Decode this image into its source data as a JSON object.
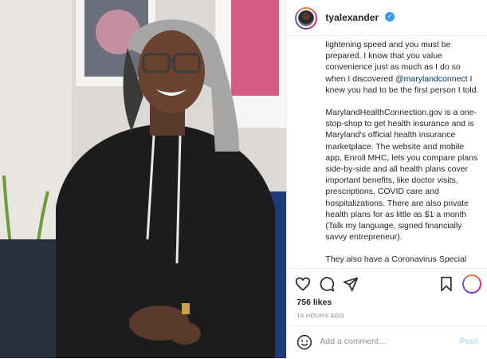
{
  "post": {
    "username": "tyalexander",
    "verified_mark": "✓",
    "caption_paragraphs": [
      {
        "before": "lightening speed and you must be prepared. I know that you value convenience just as much as I do so when I discovered ",
        "mention": "@marylandconnect",
        "after": " I knew you had to be the first person I told."
      },
      {
        "text": "MarylandHealthConnection.gov is a one-stop-shop to get health insurance and is Maryland's official health insurance marketplace. The website and mobile app, Enroll MHC, lets you compare plans side-by-side and all health plans cover important benefits, like doctor visits, prescriptions, COVID care and hospitalizations. There are also private health plans for as little as $1 a month (Talk my language, signed financially savvy entrepreneur)."
      },
      {
        "text": "They also have a Coronavirus Special"
      }
    ],
    "likes": "756 likes",
    "timestamp": "18 HOURS AGO",
    "comment_placeholder": "Add a comment…",
    "post_button": "Post"
  },
  "icons": {
    "like": "heart-outline-icon",
    "comment": "comment-bubble-icon",
    "share": "paper-plane-icon",
    "save": "bookmark-icon",
    "emoji": "smiley-face-icon",
    "avatar_overlay": "profile-thumbnail-icon"
  },
  "colors": {
    "text": "#262626",
    "secondary": "#8e8e8e",
    "mention": "#00376b",
    "verified": "#3897f0",
    "post_disabled": "#b2dffc"
  }
}
